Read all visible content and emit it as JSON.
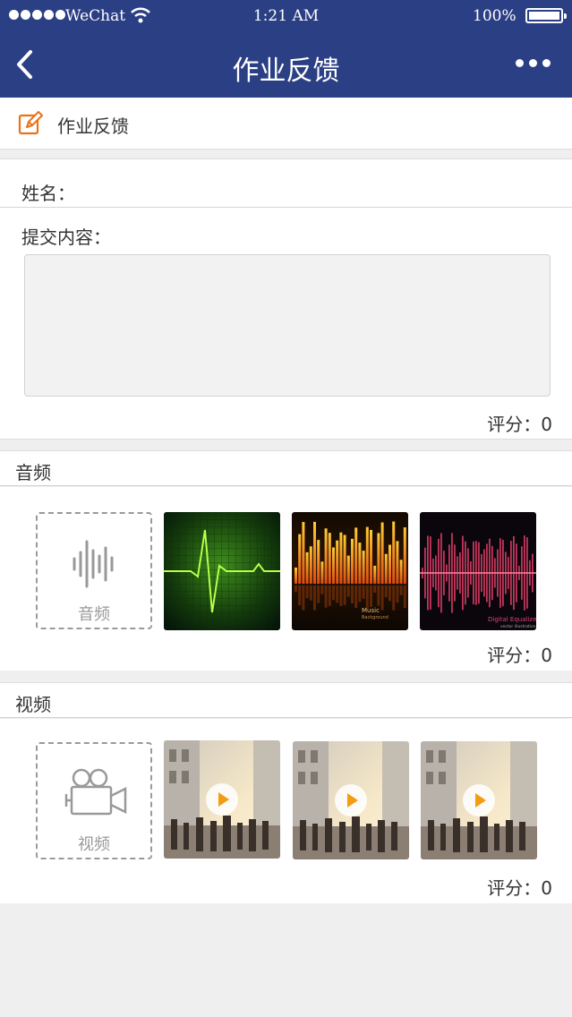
{
  "status_bar": {
    "carrier": "WeChat",
    "time": "1:21 AM",
    "battery": "100%"
  },
  "nav": {
    "title": "作业反馈"
  },
  "header": {
    "label": "作业反馈"
  },
  "form": {
    "name_label": "姓名：",
    "content_label": "提交内容：",
    "content_value": "",
    "score": "评分：0"
  },
  "audio": {
    "title": "音频",
    "add_label": "音频",
    "thumbnails": [
      {
        "caption": ""
      },
      {
        "caption": "Music",
        "subcaption": "Background"
      },
      {
        "caption": "Digital Equalizer",
        "subcaption": "vector illustration"
      }
    ],
    "score": "评分：0"
  },
  "video": {
    "title": "视频",
    "add_label": "视频",
    "score": "评分：0"
  },
  "colors": {
    "nav_bg": "#2b3f85",
    "edit_icon": "#e8731a",
    "play_icon": "#f39c12"
  }
}
